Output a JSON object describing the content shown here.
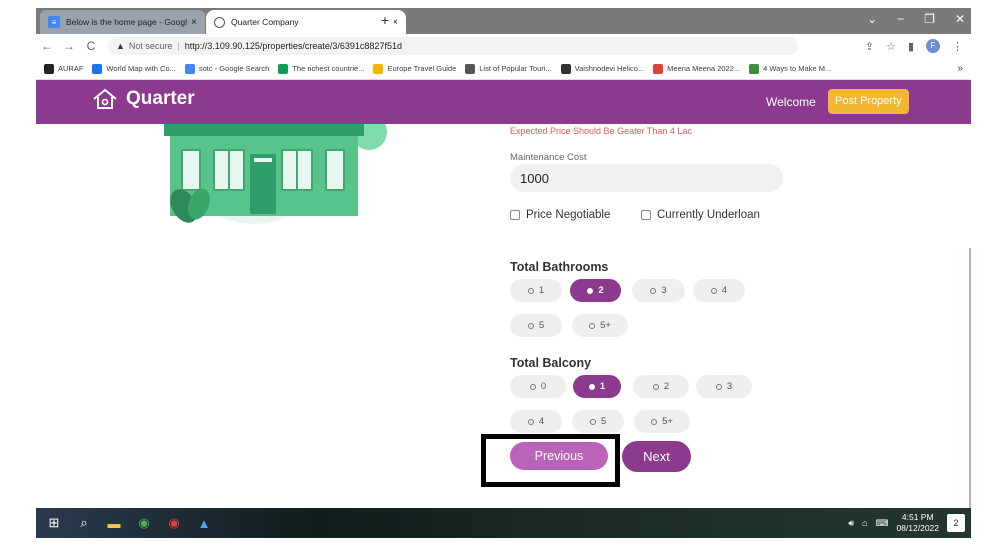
{
  "browser": {
    "tabs": [
      {
        "title": "Below is the home page - Googl",
        "close": "×",
        "icon": "google-docs-icon"
      },
      {
        "title": "Quarter Company",
        "close": "×",
        "icon": "globe-icon"
      }
    ],
    "new_tab": "+",
    "window_controls": [
      "⌄",
      "−",
      "❐",
      "✕"
    ],
    "nav": {
      "back": "←",
      "forward": "→",
      "reload": "C"
    },
    "security_text": "Not secure",
    "url": "http://3.109.90.125/properties/create/3/6391c8827f51d",
    "profile_initial": "F",
    "bookmarks": [
      {
        "label": "AURAF",
        "color": "#222222"
      },
      {
        "label": "World Map with Co...",
        "color": "#1a73e8"
      },
      {
        "label": "sotc - Google Search",
        "color": "#4285f4"
      },
      {
        "label": "The richest countrie...",
        "color": "#0f9d58"
      },
      {
        "label": "Europe Travel Guide",
        "color": "#f4b400"
      },
      {
        "label": "List of Popular Touri...",
        "color": "#555555"
      },
      {
        "label": "Vaishnodevi Helico...",
        "color": "#333333"
      },
      {
        "label": "Meena Meena 2022...",
        "color": "#db4437"
      },
      {
        "label": "4 Ways to Make M...",
        "color": "#3c8d3c"
      }
    ],
    "bookmarks_more": "»"
  },
  "site": {
    "logo_text": "Quarter",
    "welcome": "Welcome",
    "post_property": "Post Property"
  },
  "form": {
    "price_error": "Expected Price Should Be Geater Than 4 Lac",
    "maintenance_label": "Maintenance Cost",
    "maintenance_value": "1000",
    "price_negotiable": "Price Negotiable",
    "currently_underloan": "Currently Underloan",
    "bathrooms_title": "Total Bathrooms",
    "bathrooms": [
      {
        "label": "1",
        "selected": false
      },
      {
        "label": "2",
        "selected": true
      },
      {
        "label": "3",
        "selected": false
      },
      {
        "label": "4",
        "selected": false
      },
      {
        "label": "5",
        "selected": false
      },
      {
        "label": "5+",
        "selected": false
      }
    ],
    "balcony_title": "Total Balcony",
    "balcony": [
      {
        "label": "0",
        "selected": false
      },
      {
        "label": "1",
        "selected": true
      },
      {
        "label": "2",
        "selected": false
      },
      {
        "label": "3",
        "selected": false
      },
      {
        "label": "4",
        "selected": false
      },
      {
        "label": "5",
        "selected": false
      },
      {
        "label": "5+",
        "selected": false
      }
    ],
    "previous": "Previous",
    "next": "Next"
  },
  "colors": {
    "brand": "#8b3a8e",
    "accent": "#f2b632",
    "error": "#e05a5a"
  },
  "taskbar": {
    "time": "4:51 PM",
    "date": "08/12/2022",
    "notification_count": "2"
  }
}
